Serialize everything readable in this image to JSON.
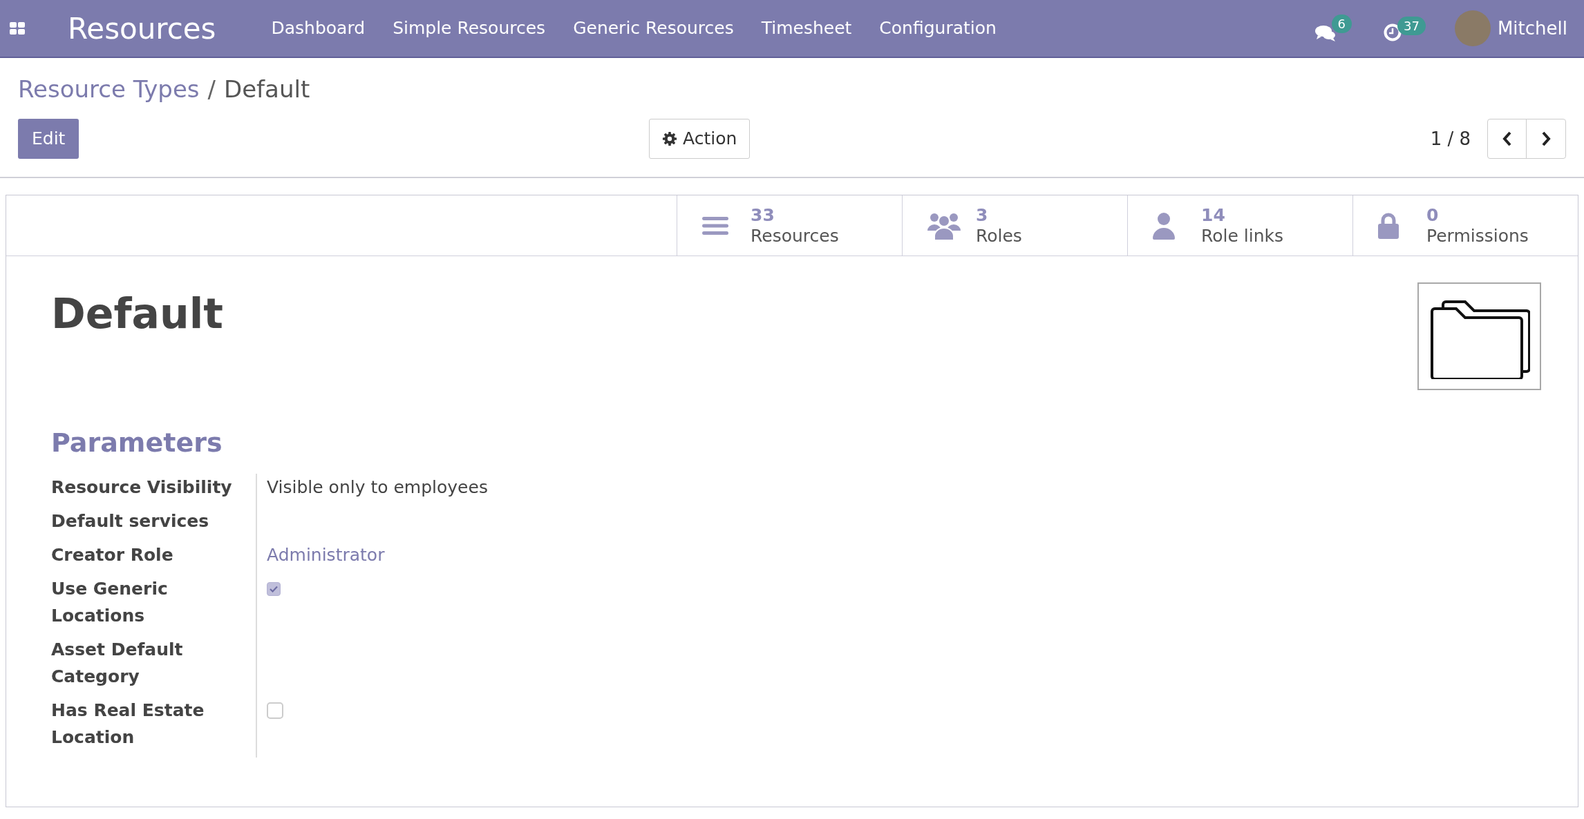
{
  "navbar": {
    "app_title": "Resources",
    "menu": [
      "Dashboard",
      "Simple Resources",
      "Generic Resources",
      "Timesheet",
      "Configuration"
    ],
    "messages_count": "6",
    "activities_count": "37",
    "user": "Mitchell"
  },
  "breadcrumb_separator": "/",
  "breadcrumb": [
    {
      "label": "Resource Types",
      "link": true
    },
    {
      "label": "Default",
      "link": false
    }
  ],
  "buttons": {
    "edit": "Edit",
    "action": "Action"
  },
  "pager": {
    "text": "1 / 8"
  },
  "stat_buttons": [
    {
      "count": "33",
      "label": "Resources"
    },
    {
      "count": "3",
      "label": "Roles"
    },
    {
      "count": "14",
      "label": "Role links"
    },
    {
      "count": "0",
      "label": "Permissions"
    }
  ],
  "record_title": "Default",
  "section_title": "Parameters",
  "fields": [
    {
      "label": "Resource Visibility",
      "kind": "text",
      "value": "Visible only to employees"
    },
    {
      "label": "Default services",
      "kind": "empty"
    },
    {
      "label": "Creator Role",
      "kind": "link",
      "value": "Administrator"
    },
    {
      "label": "Use Generic Locations",
      "kind": "checkbox",
      "checked": true
    },
    {
      "label": "Asset Default Category",
      "kind": "empty"
    },
    {
      "label": "Has Real Estate Location",
      "kind": "checkbox",
      "checked": false
    }
  ]
}
